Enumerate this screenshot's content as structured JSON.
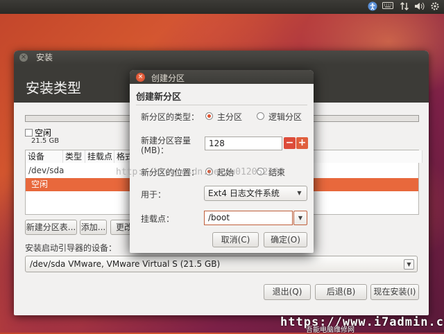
{
  "top_panel": {
    "icons": [
      "accessibility-icon",
      "keyboard-icon",
      "network-icon",
      "volume-icon",
      "settings-icon"
    ]
  },
  "main_window": {
    "title": "安装",
    "heading": "安装类型",
    "free_label": "空闲",
    "free_size": "21.5 GB",
    "table": {
      "columns": [
        "设备",
        "类型",
        "挂载点",
        "格式"
      ],
      "rows": [
        "/dev/sda",
        "空闲"
      ]
    },
    "buttons": {
      "new_table": "新建分区表...",
      "add": "添加...",
      "change": "更改"
    },
    "boot_label": "安装启动引导器的设备：",
    "boot_device": "/dev/sda  VMware, VMware Virtual S (21.5 GB)",
    "footer_buttons": {
      "quit": "退出(Q)",
      "back": "后退(B)",
      "install": "现在安装(I)"
    }
  },
  "dialog": {
    "title": "创建分区",
    "heading": "创建新分区",
    "type_label": "新分区的类型：",
    "type_primary": "主分区",
    "type_logical": "逻辑分区",
    "size_label_line1": "新建分区容量",
    "size_label_line2": "(MB)：",
    "size_value": "128",
    "minus": "−",
    "plus": "+",
    "position_label": "新分区的位置：",
    "position_start": "起始",
    "position_end": "结束",
    "use_label": "用于：",
    "use_value": "Ext4 日志文件系统",
    "mount_label": "挂载点：",
    "mount_value": "/boot",
    "cancel": "取消(C)",
    "ok": "确定(O)"
  },
  "watermarks": {
    "blog": "http://blog.csdn.net/u012052268",
    "site": "https://www.i7admin.cc",
    "site_sub": "吾能电脑维修网"
  },
  "colors": {
    "accent": "#e8683c",
    "panel": "#3c3b37"
  }
}
